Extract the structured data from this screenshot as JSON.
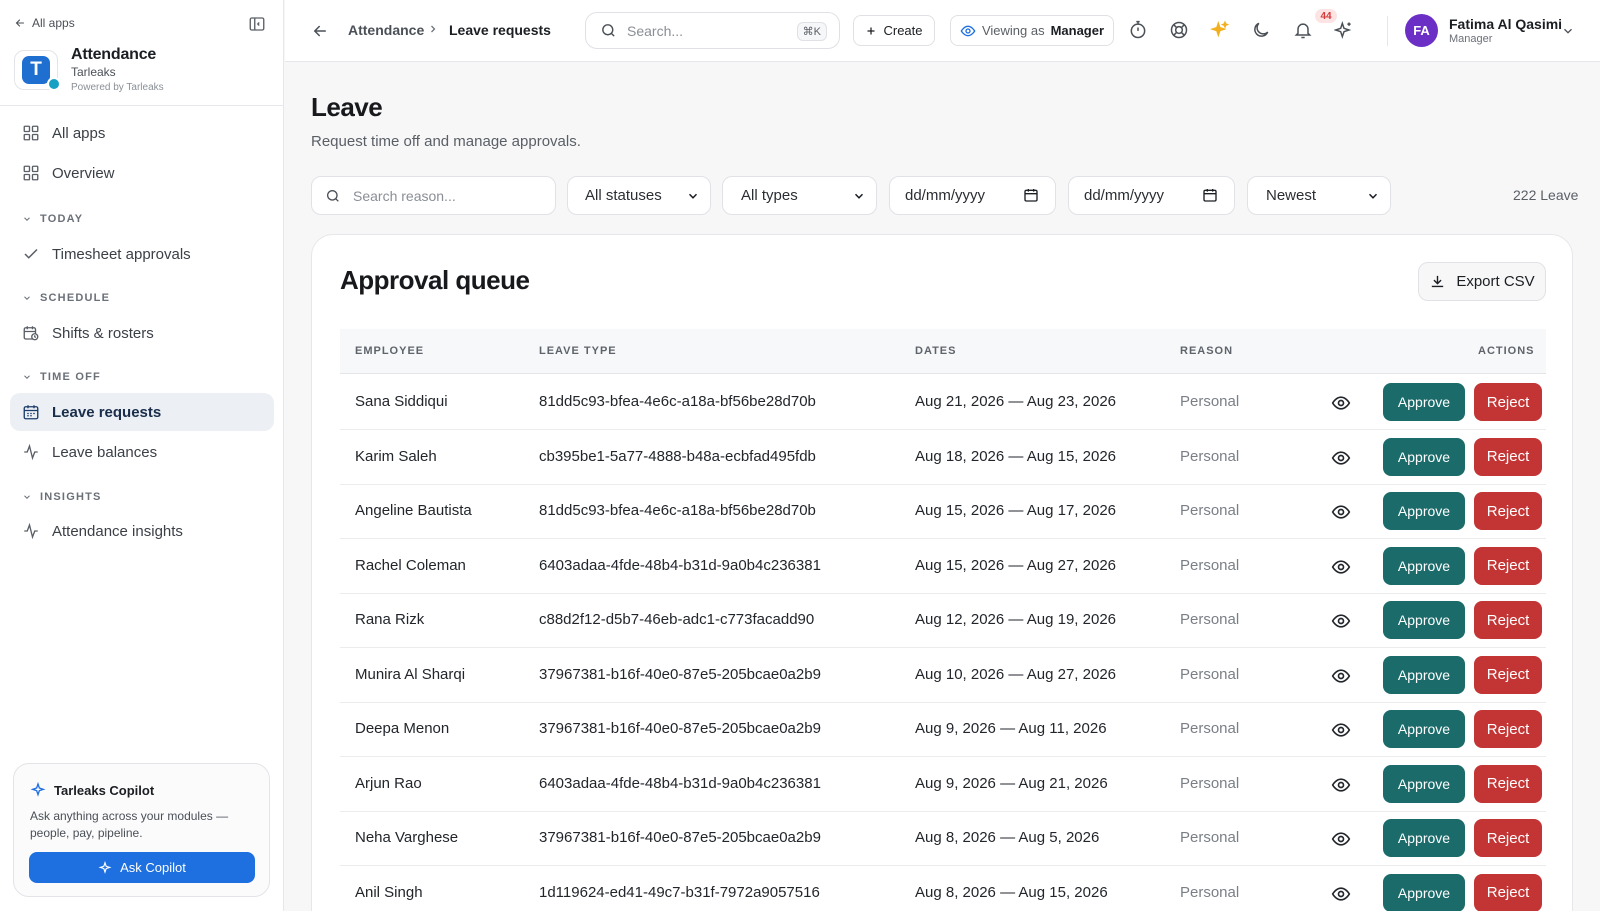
{
  "sidebar": {
    "all_apps_link": "All apps",
    "app_name": "Attendance",
    "app_org": "Tarleaks",
    "powered_by": "Powered by Tarleaks",
    "app_logo_letter": "T",
    "nav": {
      "all_apps": "All apps",
      "overview": "Overview",
      "section_today": "TODAY",
      "timesheet_approvals": "Timesheet approvals",
      "section_schedule": "SCHEDULE",
      "shifts_rosters": "Shifts & rosters",
      "section_time_off": "TIME OFF",
      "leave_requests": "Leave requests",
      "leave_balances": "Leave balances",
      "section_insights": "INSIGHTS",
      "attendance_insights": "Attendance insights"
    },
    "copilot": {
      "title": "Tarleaks Copilot",
      "description": "Ask anything across your modules — people, pay, pipeline.",
      "button": "Ask Copilot"
    }
  },
  "topbar": {
    "breadcrumb": [
      "Attendance",
      "Leave requests"
    ],
    "search_placeholder": "Search...",
    "search_shortcut": "⌘K",
    "create_label": "Create",
    "viewing_as_label": "Viewing as",
    "viewing_as_role": "Manager",
    "notification_count": "44",
    "user": {
      "initials": "FA",
      "name": "Fatima Al Qasimi",
      "role": "Manager"
    }
  },
  "main": {
    "title": "Leave",
    "subtitle": "Request time off and manage approvals.",
    "filters": {
      "search_placeholder": "Search reason...",
      "status": "All statuses",
      "type": "All types",
      "date_from": "dd/mm/yyyy",
      "date_to": "dd/mm/yyyy",
      "sort": "Newest"
    },
    "count_label": "222 Leave",
    "queue": {
      "title": "Approval queue",
      "export_label": "Export CSV",
      "columns": [
        "EMPLOYEE",
        "LEAVE TYPE",
        "DATES",
        "REASON",
        "ACTIONS"
      ],
      "approve_label": "Approve",
      "reject_label": "Reject",
      "rows": [
        {
          "employee": "Sana Siddiqui",
          "leave_type": "81dd5c93-bfea-4e6c-a18a-bf56be28d70b",
          "dates": "Aug 21, 2026 — Aug 23, 2026",
          "reason": "Personal"
        },
        {
          "employee": "Karim Saleh",
          "leave_type": "cb395be1-5a77-4888-b48a-ecbfad495fdb",
          "dates": "Aug 18, 2026 — Aug 15, 2026",
          "reason": "Personal"
        },
        {
          "employee": "Angeline Bautista",
          "leave_type": "81dd5c93-bfea-4e6c-a18a-bf56be28d70b",
          "dates": "Aug 15, 2026 — Aug 17, 2026",
          "reason": "Personal"
        },
        {
          "employee": "Rachel Coleman",
          "leave_type": "6403adaa-4fde-48b4-b31d-9a0b4c236381",
          "dates": "Aug 15, 2026 — Aug 27, 2026",
          "reason": "Personal"
        },
        {
          "employee": "Rana Rizk",
          "leave_type": "c88d2f12-d5b7-46eb-adc1-c773facadd90",
          "dates": "Aug 12, 2026 — Aug 19, 2026",
          "reason": "Personal"
        },
        {
          "employee": "Munira Al Sharqi",
          "leave_type": "37967381-b16f-40e0-87e5-205bcae0a2b9",
          "dates": "Aug 10, 2026 — Aug 27, 2026",
          "reason": "Personal"
        },
        {
          "employee": "Deepa Menon",
          "leave_type": "37967381-b16f-40e0-87e5-205bcae0a2b9",
          "dates": "Aug 9, 2026 — Aug 11, 2026",
          "reason": "Personal"
        },
        {
          "employee": "Arjun Rao",
          "leave_type": "6403adaa-4fde-48b4-b31d-9a0b4c236381",
          "dates": "Aug 9, 2026 — Aug 21, 2026",
          "reason": "Personal"
        },
        {
          "employee": "Neha Varghese",
          "leave_type": "37967381-b16f-40e0-87e5-205bcae0a2b9",
          "dates": "Aug 8, 2026 — Aug 5, 2026",
          "reason": "Personal"
        },
        {
          "employee": "Anil Singh",
          "leave_type": "1d119624-ed41-49c7-b31f-7972a9057516",
          "dates": "Aug 8, 2026 — Aug 15, 2026",
          "reason": "Personal"
        }
      ]
    }
  },
  "colors": {
    "accent": "#1e6fe0",
    "approve": "#1b6b6a",
    "reject": "#c33535",
    "avatar": "#6b2fc6"
  }
}
